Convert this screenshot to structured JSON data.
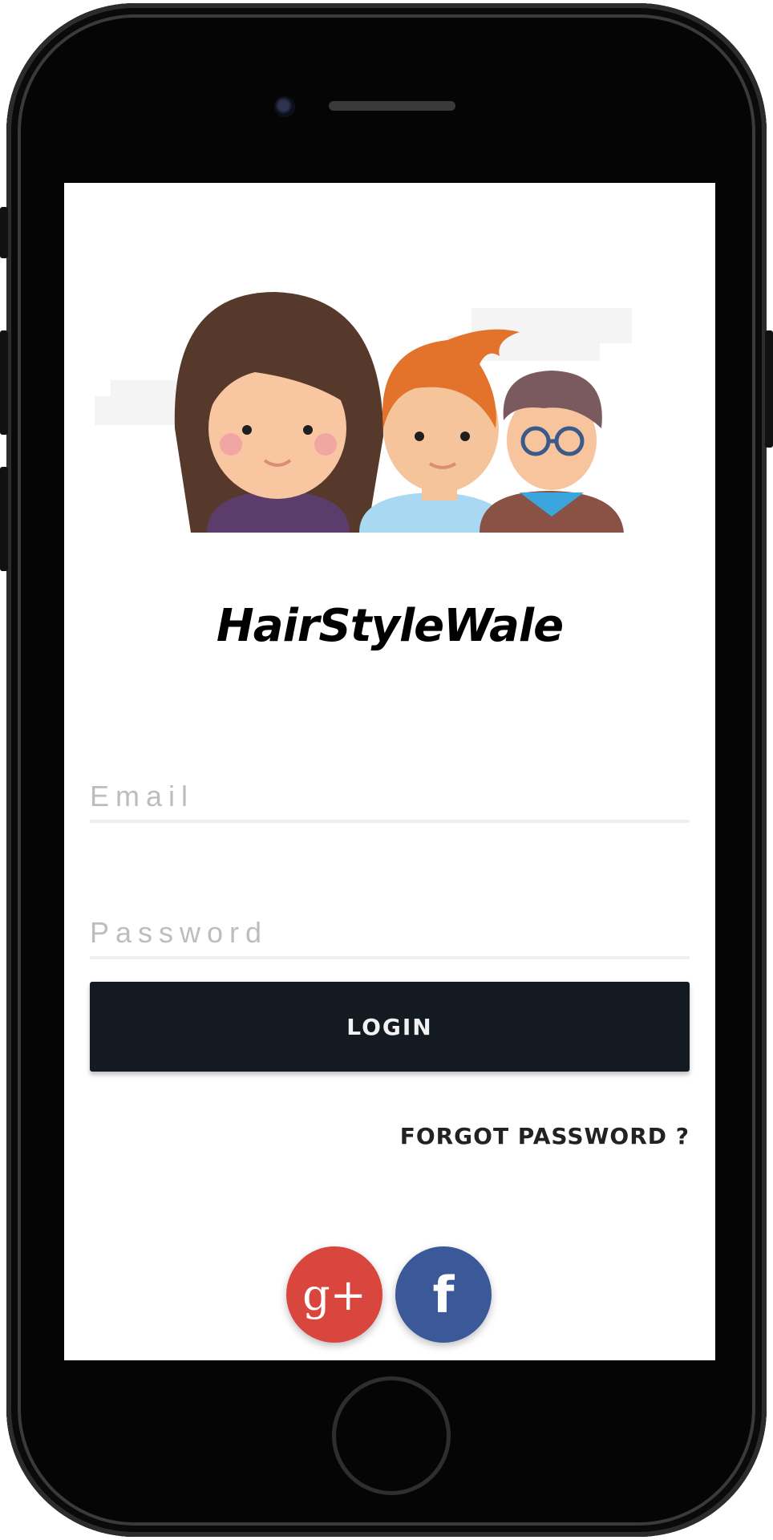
{
  "app": {
    "title": "HairStyleWale"
  },
  "login_form": {
    "email_placeholder": "Email",
    "password_placeholder": "Password",
    "login_label": "LOGIN",
    "forgot_label": "FORGOT PASSWORD ?"
  },
  "social": {
    "google_label": "g+",
    "facebook_label": "f"
  },
  "colors": {
    "login_button": "#141a22",
    "google": "#d9463e",
    "facebook": "#3b5998"
  },
  "icons": [
    "avatar-group-illustration",
    "google-plus-icon",
    "facebook-icon"
  ]
}
